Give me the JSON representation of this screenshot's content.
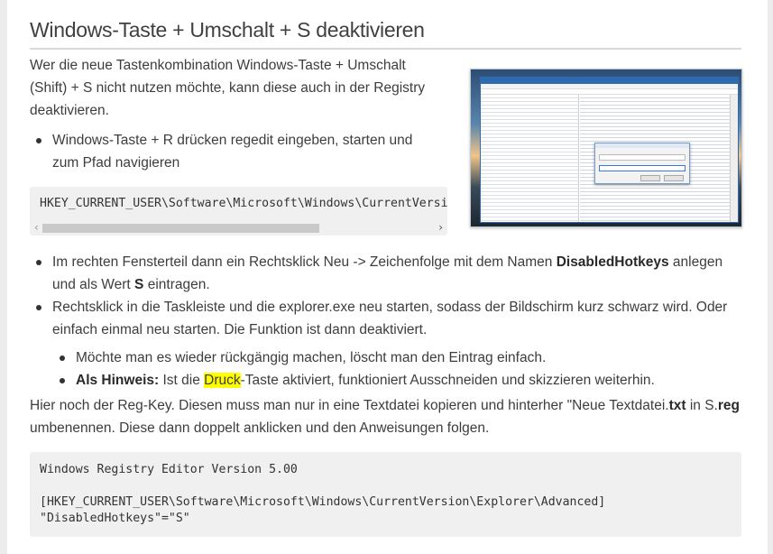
{
  "heading": "Windows-Taste + Umschalt + S deaktivieren",
  "intro": "Wer die neue Tastenkombination Windows-Taste + Umschalt (Shift) + S nicht nutzen möchte, kann diese auch in der Registry deaktivieren.",
  "bullet_1": "Windows-Taste + R drücken regedit eingeben, starten und zum Pfad navigieren",
  "code_short": "HKEY_CURRENT_USER\\Software\\Microsoft\\Windows\\CurrentVersion\\Explorer\\Advanced",
  "scroll_left_glyph": "‹",
  "scroll_right_glyph": "›",
  "screenshot_icon": "registry-editor-screenshot",
  "bullet_2": {
    "part1": "Im rechten Fensterteil dann ein Rechtsklick Neu -> Zeichenfolge mit dem Namen ",
    "bold1": "DisabledHotkeys",
    "part2": " anlegen und als Wert ",
    "bold2": "S",
    "part3": " eintragen."
  },
  "bullet_3": "Rechtsklick in die Taskleiste und die explorer.exe neu starten, sodass der Bildschirm kurz schwarz wird. Oder einfach einmal neu starten. Die Funktion ist dann deaktiviert.",
  "sub_bullet_1": "Möchte man es wieder rückgängig machen, löscht man den Eintrag einfach.",
  "sub_bullet_2": {
    "label": "Als Hinweis:",
    "part1": " Ist die ",
    "highlight": "Druck",
    "part2": "-Taste aktiviert, funktioniert Ausschneiden und skizzieren weiterhin."
  },
  "outro": {
    "part1": "Hier noch der Reg-Key. Diesen muss man nur in eine Textdatei kopieren und hinterher \"Neue Textdatei.",
    "bold1": "txt",
    "part2": " in S.",
    "bold2": "reg",
    "part3": " umbenennen. Diese dann doppelt anklicken und den Anweisungen folgen."
  },
  "code_long": {
    "line1": "Windows Registry Editor Version 5.00",
    "line2": "[HKEY_CURRENT_USER\\Software\\Microsoft\\Windows\\CurrentVersion\\Explorer\\Advanced]",
    "line3": "\"DisabledHotkeys\"=\"S\""
  },
  "colors": {
    "highlight": "#ffff00",
    "code_bg": "#f0f0f0",
    "rule": "#d9d9d9"
  }
}
